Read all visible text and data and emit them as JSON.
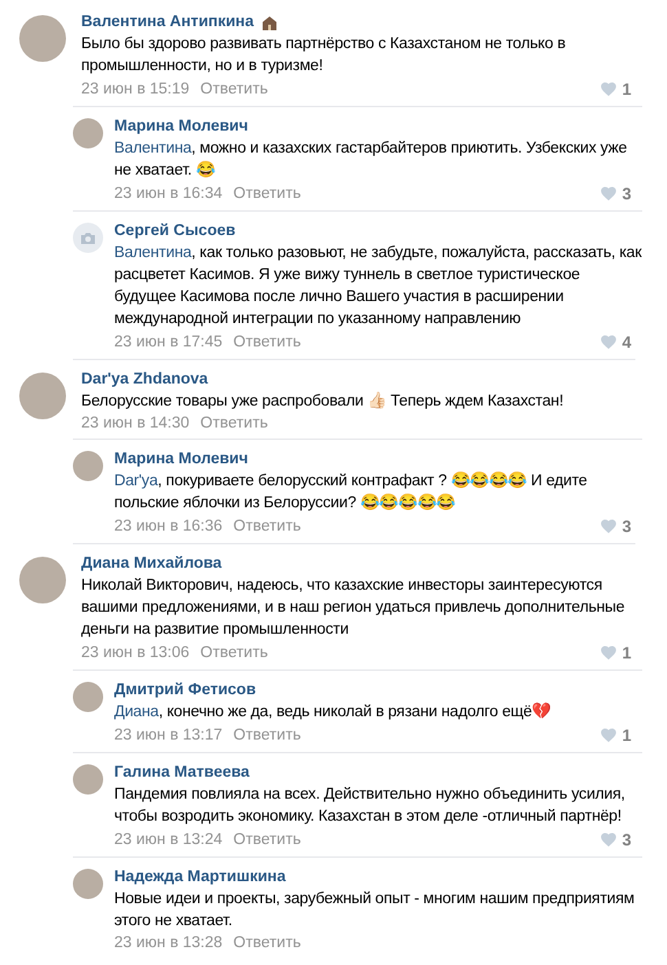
{
  "comments": [
    {
      "author": "Валентина Антипкина",
      "status_icon": true,
      "kind": "photo",
      "text": "Было бы здорово развивать партнёрство с Казахстаном не только в промышленности, но и в туризме!",
      "date": "23 июн в 15:19",
      "reply": "Ответить",
      "likes": "1",
      "replies": [
        {
          "author": "Марина Молевич",
          "status_icon": false,
          "kind": "photo",
          "mention": "Валентина",
          "text": ", можно и казахских гастарбайтеров приютить. Узбекских уже не хватает. 😂",
          "date": "23 июн в 16:34",
          "reply": "Ответить",
          "likes": "3"
        },
        {
          "author": "Сергей Сысоев",
          "status_icon": false,
          "kind": "camera",
          "mention": "Валентина",
          "text": ", как только разовьют, не забудьте, пожалуйста, рассказать, как расцветет Касимов. Я уже вижу туннель в светлое туристическое будущее Касимова после лично Вашего участия в расширении международной интеграции по указанному направлению",
          "date": "23 июн в 17:45",
          "reply": "Ответить",
          "likes": "4"
        }
      ]
    },
    {
      "author": "Dar'ya Zhdanova",
      "status_icon": false,
      "kind": "photo",
      "text": "Белорусские товары уже распробовали 👍🏻 Теперь ждем Казахстан!",
      "date": "23 июн в 14:30",
      "reply": "Ответить",
      "replies": [
        {
          "author": "Марина Молевич",
          "status_icon": false,
          "kind": "photo",
          "mention": "Dar'ya",
          "text": ", покуриваете белорусский контрафакт ? 😂😂😂😂 И едите польские яблочки из Белоруссии? 😂😂😂😂😂",
          "date": "23 июн в 16:36",
          "reply": "Ответить",
          "likes": "3"
        }
      ]
    },
    {
      "author": "Диана Михайлова",
      "status_icon": false,
      "kind": "photo",
      "text": "Николай Викторович, надеюсь, что казахские инвесторы заинтересуются вашими предложениями, и в наш регион удаться привлечь дополнительные деньги на развитие промышленности",
      "date": "23 июн в 13:06",
      "reply": "Ответить",
      "likes": "1",
      "replies": [
        {
          "author": "Дмитрий Фетисов",
          "status_icon": false,
          "kind": "photo",
          "mention": "Диана",
          "text": ", конечно же да, ведь николай в рязани надолго ещё💔",
          "date": "23 июн в 13:17",
          "reply": "Ответить",
          "likes": "1"
        },
        {
          "author": "Галина Матвеева",
          "status_icon": false,
          "kind": "photo",
          "text": "Пандемия повлияла на всех. Действительно нужно объединить усилия, чтобы возродить экономику. Казахстан в этом деле -отличный партнёр!",
          "date": "23 июн в 13:24",
          "reply": "Ответить",
          "likes": "3"
        },
        {
          "author": "Надежда Мартишкина",
          "status_icon": false,
          "kind": "photo",
          "text": "Новые идеи и проекты, зарубежный опыт - многим нашим предприятиям этого не хватает.",
          "date": "23 июн в 13:28",
          "reply": "Ответить"
        }
      ]
    }
  ]
}
